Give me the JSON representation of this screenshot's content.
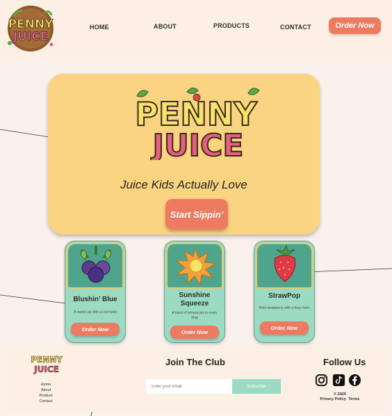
{
  "brand": {
    "logo_line1": "PENNY",
    "logo_line2": "JUICE"
  },
  "nav": {
    "items": [
      {
        "label": "HOME"
      },
      {
        "label": "ABOUT"
      },
      {
        "label": "PRODUCTS"
      },
      {
        "label": "CONTACT"
      }
    ],
    "cta": "Order Now"
  },
  "hero": {
    "tagline": "Juice Kids Actually Love",
    "cta": "Start Sippin’"
  },
  "products": [
    {
      "name": "Blushin’ Blue",
      "description": "A sweet sip with a cool twist",
      "cta": "Order Now",
      "icon": "blueberry-icon"
    },
    {
      "name": "Sunshine Squeeze",
      "description": "A burst of lemony joy in every drop",
      "cta": "Order Now",
      "icon": "orange-splash-icon"
    },
    {
      "name": "StrawPop",
      "description": "Bold strawberry with a fizzy twist",
      "cta": "Order Now",
      "icon": "strawberry-icon"
    }
  ],
  "footer": {
    "links": [
      "Home",
      "About",
      "Product",
      "Contact"
    ],
    "join_title": "Join The Club",
    "email_placeholder": "Enter your email",
    "subscribe": "Subscribe",
    "follow_title": "Follow Us",
    "social": [
      "instagram-icon",
      "tiktok-icon",
      "facebook-icon"
    ],
    "copyright": "© 2025",
    "privacy": "Privacy Policy",
    "terms": "Terms"
  },
  "colors": {
    "background": "#fbf1ec",
    "header": "#fcefe3",
    "hero": "#fad481",
    "accent": "#ee7a62",
    "mint": "#9bdbc3",
    "teal": "#4fa58b"
  }
}
